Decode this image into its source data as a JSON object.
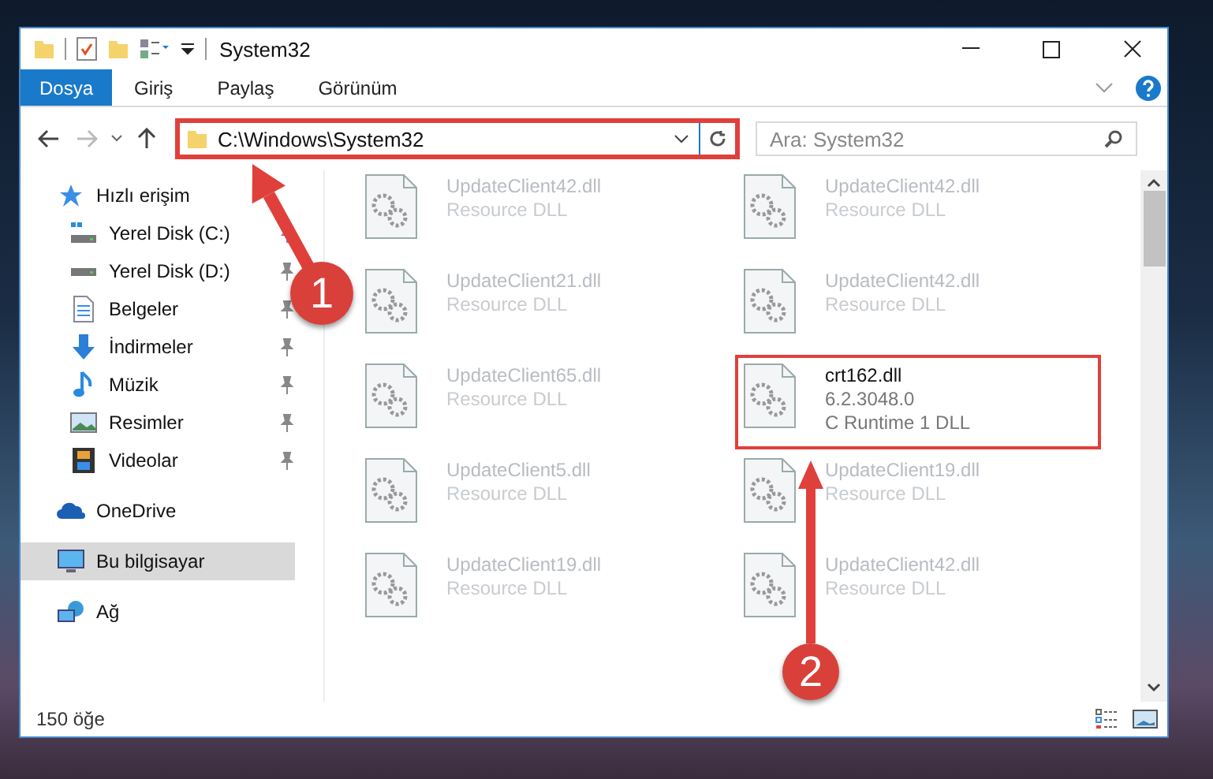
{
  "window": {
    "title": "System32"
  },
  "ribbon_tabs": [
    {
      "label": "Dosya",
      "selected": true
    },
    {
      "label": "Giriş",
      "selected": false
    },
    {
      "label": "Paylaş",
      "selected": false
    },
    {
      "label": "Görünüm",
      "selected": false
    }
  ],
  "address_bar": {
    "path": "C:\\Windows\\System32",
    "highlighted": true
  },
  "search": {
    "placeholder": "Ara: System32"
  },
  "sidebar": {
    "items": [
      {
        "label": "Hızlı erişim",
        "kind": "quick-access",
        "selected": false,
        "children": [
          {
            "label": "Yerel Disk (C:)",
            "kind": "system-drive",
            "pinned": true,
            "selected": false
          },
          {
            "label": "Yerel Disk (D:)",
            "kind": "drive",
            "pinned": true,
            "selected": false
          },
          {
            "label": "Belgeler",
            "kind": "documents",
            "pinned": true,
            "selected": false
          },
          {
            "label": "İndirmeler",
            "kind": "downloads",
            "pinned": true,
            "selected": false
          },
          {
            "label": "Müzik",
            "kind": "music",
            "pinned": true,
            "selected": false
          },
          {
            "label": "Resimler",
            "kind": "pictures",
            "pinned": true,
            "selected": false
          },
          {
            "label": "Videolar",
            "kind": "videos",
            "pinned": true,
            "selected": false
          }
        ]
      },
      {
        "label": "OneDrive",
        "kind": "cloud",
        "selected": false
      },
      {
        "label": "Bu bilgisayar",
        "kind": "computer",
        "selected": true
      },
      {
        "label": "Ağ",
        "kind": "network",
        "selected": false
      }
    ]
  },
  "files": [
    {
      "name": "UpdateClient42.dll",
      "details": [
        "Resource DLL"
      ],
      "highlighted": false
    },
    {
      "name": "UpdateClient42.dll",
      "details": [
        "Resource DLL"
      ],
      "highlighted": false
    },
    {
      "name": "UpdateClient21.dll",
      "details": [
        "Resource DLL"
      ],
      "highlighted": false
    },
    {
      "name": "UpdateClient42.dll",
      "details": [
        "Resource DLL"
      ],
      "highlighted": false
    },
    {
      "name": "UpdateClient65.dll",
      "details": [
        "Resource DLL"
      ],
      "highlighted": false
    },
    {
      "name": "crt162.dll",
      "details": [
        "6.2.3048.0",
        "C Runtime 1 DLL"
      ],
      "highlighted": true
    },
    {
      "name": "UpdateClient5.dll",
      "details": [
        "Resource DLL"
      ],
      "highlighted": false
    },
    {
      "name": "UpdateClient19.dll",
      "details": [
        "Resource DLL"
      ],
      "highlighted": false
    },
    {
      "name": "UpdateClient19.dll",
      "details": [
        "Resource DLL"
      ],
      "highlighted": false
    },
    {
      "name": "UpdateClient42.dll",
      "details": [
        "Resource DLL"
      ],
      "highlighted": false
    }
  ],
  "status_bar": {
    "count": "150 öğe"
  },
  "annotations": [
    {
      "number": "1"
    },
    {
      "number": "2"
    }
  ]
}
